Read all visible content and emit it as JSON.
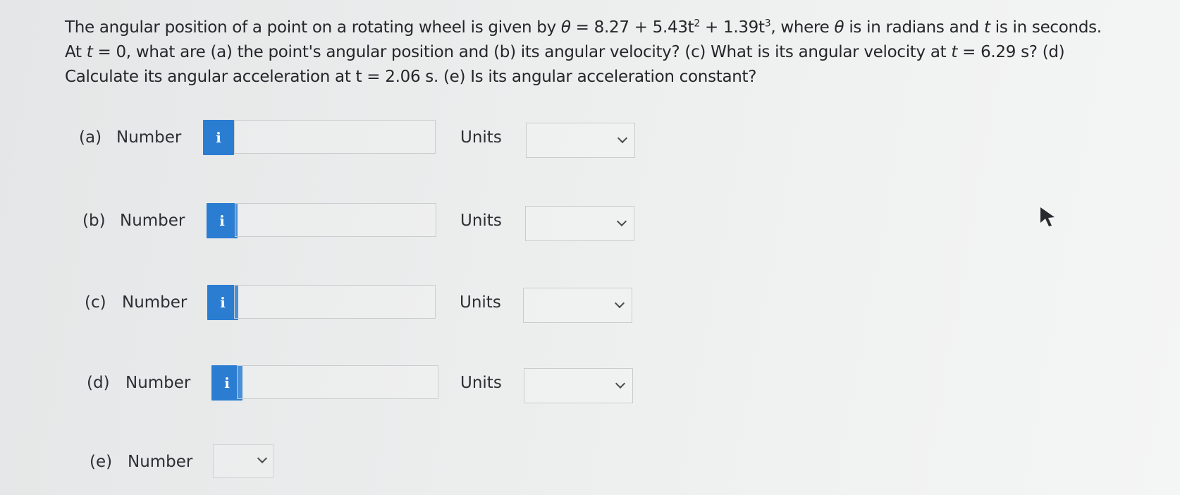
{
  "question": {
    "p1": "The angular position of a point on a rotating wheel is given by ",
    "theta1": "θ",
    "eq_a": " = 8.27 + 5.43t",
    "sup2": "2",
    "eq_b": " + 1.39t",
    "sup3": "3",
    "p2": ", where ",
    "theta2": "θ",
    "p3": " is in radians and ",
    "t1": "t",
    "p4": " is in seconds. At ",
    "t2": "t",
    "p5": " = 0, what are (a) the point's angular position and (b) its angular velocity? (c) What is its angular velocity at ",
    "t3": "t",
    "p6": " = 6.29 s? (d) Calculate its angular acceleration at t = 2.06 s. (e) Is its angular acceleration constant?"
  },
  "parts": [
    {
      "label": "(a)",
      "number_label": "Number",
      "info": "i",
      "value": "",
      "units_label": "Units",
      "units_value": ""
    },
    {
      "label": "(b)",
      "number_label": "Number",
      "info": "i",
      "value": "",
      "units_label": "Units",
      "units_value": ""
    },
    {
      "label": "(c)",
      "number_label": "Number",
      "info": "i",
      "value": "",
      "units_label": "Units",
      "units_value": ""
    },
    {
      "label": "(d)",
      "number_label": "Number",
      "info": "i",
      "value": "",
      "units_label": "Units",
      "units_value": ""
    }
  ],
  "part_e": {
    "label": "(e)",
    "number_label": "Number",
    "value": ""
  },
  "colors": {
    "info_button": "#2b7dd1",
    "background": "#eceeee",
    "text": "#26262a",
    "border": "#c9cbcd"
  },
  "icons": {
    "info": "info-icon",
    "dropdown": "chevron-down-icon",
    "cursor": "mouse-pointer-icon"
  }
}
